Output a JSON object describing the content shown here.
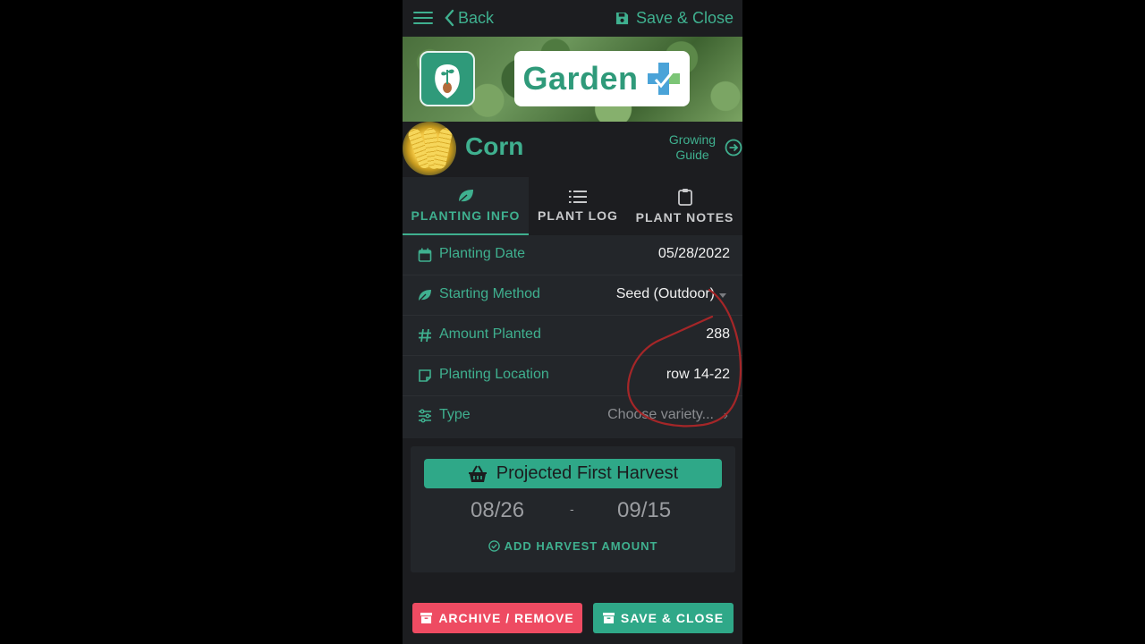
{
  "topbar": {
    "back_label": "Back",
    "save_close_label": "Save & Close"
  },
  "banner": {
    "brand_word": "Garden"
  },
  "plant": {
    "name": "Corn",
    "growing_guide_line1": "Growing",
    "growing_guide_line2": "Guide"
  },
  "tabs": [
    {
      "label": "PLANTING INFO",
      "icon": "leaf-icon",
      "active": true
    },
    {
      "label": "PLANT LOG",
      "icon": "list-icon",
      "active": false
    },
    {
      "label": "PLANT NOTES",
      "icon": "clipboard-icon",
      "active": false
    }
  ],
  "fields": {
    "planting_date": {
      "label": "Planting Date",
      "value": "05/28/2022"
    },
    "starting_method": {
      "label": "Starting Method",
      "value": "Seed (Outdoor)"
    },
    "amount_planted": {
      "label": "Amount Planted",
      "value": "288"
    },
    "planting_location": {
      "label": "Planting Location",
      "value": "row 14-22"
    },
    "type": {
      "label": "Type",
      "value": "Choose variety..."
    }
  },
  "harvest": {
    "title": "Projected First Harvest",
    "start": "08/26",
    "separator": "-",
    "end": "09/15",
    "add_label": "ADD HARVEST AMOUNT"
  },
  "footer": {
    "archive_label": "ARCHIVE / REMOVE",
    "save_label": "SAVE & CLOSE"
  },
  "colors": {
    "accent": "#3fb08f",
    "danger": "#ee4b62",
    "background": "#1c1d20"
  }
}
